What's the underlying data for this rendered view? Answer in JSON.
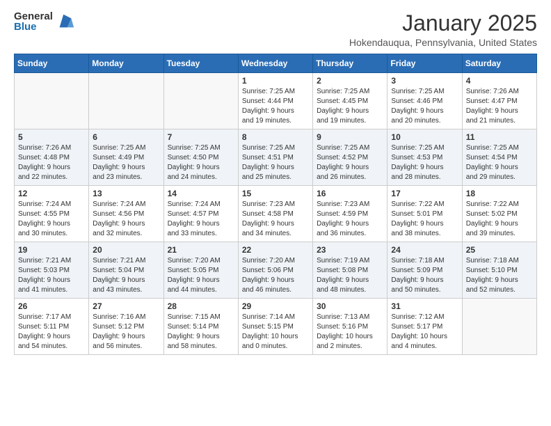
{
  "logo": {
    "general": "General",
    "blue": "Blue"
  },
  "header": {
    "month": "January 2025",
    "location": "Hokendauqua, Pennsylvania, United States"
  },
  "weekdays": [
    "Sunday",
    "Monday",
    "Tuesday",
    "Wednesday",
    "Thursday",
    "Friday",
    "Saturday"
  ],
  "weeks": [
    [
      {
        "day": "",
        "info": ""
      },
      {
        "day": "",
        "info": ""
      },
      {
        "day": "",
        "info": ""
      },
      {
        "day": "1",
        "info": "Sunrise: 7:25 AM\nSunset: 4:44 PM\nDaylight: 9 hours\nand 19 minutes."
      },
      {
        "day": "2",
        "info": "Sunrise: 7:25 AM\nSunset: 4:45 PM\nDaylight: 9 hours\nand 19 minutes."
      },
      {
        "day": "3",
        "info": "Sunrise: 7:25 AM\nSunset: 4:46 PM\nDaylight: 9 hours\nand 20 minutes."
      },
      {
        "day": "4",
        "info": "Sunrise: 7:26 AM\nSunset: 4:47 PM\nDaylight: 9 hours\nand 21 minutes."
      }
    ],
    [
      {
        "day": "5",
        "info": "Sunrise: 7:26 AM\nSunset: 4:48 PM\nDaylight: 9 hours\nand 22 minutes."
      },
      {
        "day": "6",
        "info": "Sunrise: 7:25 AM\nSunset: 4:49 PM\nDaylight: 9 hours\nand 23 minutes."
      },
      {
        "day": "7",
        "info": "Sunrise: 7:25 AM\nSunset: 4:50 PM\nDaylight: 9 hours\nand 24 minutes."
      },
      {
        "day": "8",
        "info": "Sunrise: 7:25 AM\nSunset: 4:51 PM\nDaylight: 9 hours\nand 25 minutes."
      },
      {
        "day": "9",
        "info": "Sunrise: 7:25 AM\nSunset: 4:52 PM\nDaylight: 9 hours\nand 26 minutes."
      },
      {
        "day": "10",
        "info": "Sunrise: 7:25 AM\nSunset: 4:53 PM\nDaylight: 9 hours\nand 28 minutes."
      },
      {
        "day": "11",
        "info": "Sunrise: 7:25 AM\nSunset: 4:54 PM\nDaylight: 9 hours\nand 29 minutes."
      }
    ],
    [
      {
        "day": "12",
        "info": "Sunrise: 7:24 AM\nSunset: 4:55 PM\nDaylight: 9 hours\nand 30 minutes."
      },
      {
        "day": "13",
        "info": "Sunrise: 7:24 AM\nSunset: 4:56 PM\nDaylight: 9 hours\nand 32 minutes."
      },
      {
        "day": "14",
        "info": "Sunrise: 7:24 AM\nSunset: 4:57 PM\nDaylight: 9 hours\nand 33 minutes."
      },
      {
        "day": "15",
        "info": "Sunrise: 7:23 AM\nSunset: 4:58 PM\nDaylight: 9 hours\nand 34 minutes."
      },
      {
        "day": "16",
        "info": "Sunrise: 7:23 AM\nSunset: 4:59 PM\nDaylight: 9 hours\nand 36 minutes."
      },
      {
        "day": "17",
        "info": "Sunrise: 7:22 AM\nSunset: 5:01 PM\nDaylight: 9 hours\nand 38 minutes."
      },
      {
        "day": "18",
        "info": "Sunrise: 7:22 AM\nSunset: 5:02 PM\nDaylight: 9 hours\nand 39 minutes."
      }
    ],
    [
      {
        "day": "19",
        "info": "Sunrise: 7:21 AM\nSunset: 5:03 PM\nDaylight: 9 hours\nand 41 minutes."
      },
      {
        "day": "20",
        "info": "Sunrise: 7:21 AM\nSunset: 5:04 PM\nDaylight: 9 hours\nand 43 minutes."
      },
      {
        "day": "21",
        "info": "Sunrise: 7:20 AM\nSunset: 5:05 PM\nDaylight: 9 hours\nand 44 minutes."
      },
      {
        "day": "22",
        "info": "Sunrise: 7:20 AM\nSunset: 5:06 PM\nDaylight: 9 hours\nand 46 minutes."
      },
      {
        "day": "23",
        "info": "Sunrise: 7:19 AM\nSunset: 5:08 PM\nDaylight: 9 hours\nand 48 minutes."
      },
      {
        "day": "24",
        "info": "Sunrise: 7:18 AM\nSunset: 5:09 PM\nDaylight: 9 hours\nand 50 minutes."
      },
      {
        "day": "25",
        "info": "Sunrise: 7:18 AM\nSunset: 5:10 PM\nDaylight: 9 hours\nand 52 minutes."
      }
    ],
    [
      {
        "day": "26",
        "info": "Sunrise: 7:17 AM\nSunset: 5:11 PM\nDaylight: 9 hours\nand 54 minutes."
      },
      {
        "day": "27",
        "info": "Sunrise: 7:16 AM\nSunset: 5:12 PM\nDaylight: 9 hours\nand 56 minutes."
      },
      {
        "day": "28",
        "info": "Sunrise: 7:15 AM\nSunset: 5:14 PM\nDaylight: 9 hours\nand 58 minutes."
      },
      {
        "day": "29",
        "info": "Sunrise: 7:14 AM\nSunset: 5:15 PM\nDaylight: 10 hours\nand 0 minutes."
      },
      {
        "day": "30",
        "info": "Sunrise: 7:13 AM\nSunset: 5:16 PM\nDaylight: 10 hours\nand 2 minutes."
      },
      {
        "day": "31",
        "info": "Sunrise: 7:12 AM\nSunset: 5:17 PM\nDaylight: 10 hours\nand 4 minutes."
      },
      {
        "day": "",
        "info": ""
      }
    ]
  ]
}
